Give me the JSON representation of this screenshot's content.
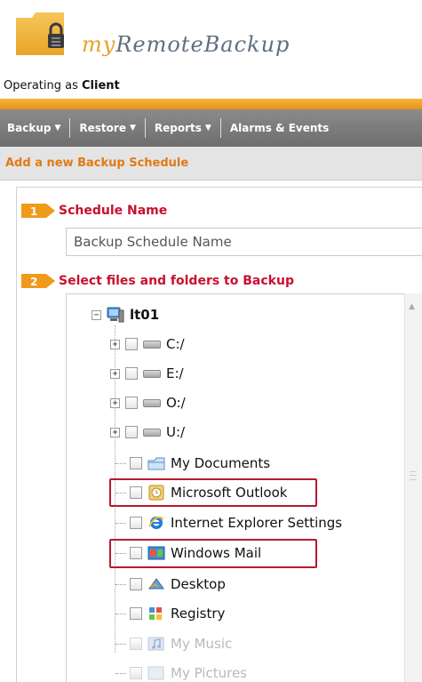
{
  "header": {
    "logo_my": "my",
    "logo_rest": "RemoteBackup",
    "operating_prefix": "Operating as ",
    "operating_role": "Client"
  },
  "nav": {
    "items": [
      {
        "label": "Backup"
      },
      {
        "label": "Restore"
      },
      {
        "label": "Reports"
      },
      {
        "label": "Alarms & Events"
      }
    ]
  },
  "page": {
    "subtitle": "Add a new Backup Schedule"
  },
  "steps": [
    {
      "number": "1",
      "label": "Schedule Name"
    },
    {
      "number": "2",
      "label": "Select files and folders to Backup"
    }
  ],
  "schedule_name_input": {
    "value": "Backup Schedule Name"
  },
  "tree": {
    "root": {
      "label": "lt01"
    },
    "drives": [
      {
        "label": "C:/"
      },
      {
        "label": "E:/"
      },
      {
        "label": "O:/"
      },
      {
        "label": "U:/"
      }
    ],
    "items": [
      {
        "label": "My Documents",
        "icon": "my-documents-icon"
      },
      {
        "label": "Microsoft Outlook",
        "icon": "outlook-icon",
        "highlighted": true
      },
      {
        "label": "Internet Explorer Settings",
        "icon": "internet-explorer-icon"
      },
      {
        "label": "Windows Mail",
        "icon": "windows-mail-icon",
        "highlighted": true
      },
      {
        "label": "Desktop",
        "icon": "desktop-icon"
      },
      {
        "label": "Registry",
        "icon": "registry-icon"
      },
      {
        "label": "My Music",
        "icon": "music-icon"
      },
      {
        "label": "My Pictures",
        "icon": "pictures-icon"
      }
    ]
  },
  "colors": {
    "accent_orange": "#e59215",
    "step_red": "#c8102e",
    "highlight_red": "#b8192e",
    "nav_gray": "#7a7a7a"
  }
}
